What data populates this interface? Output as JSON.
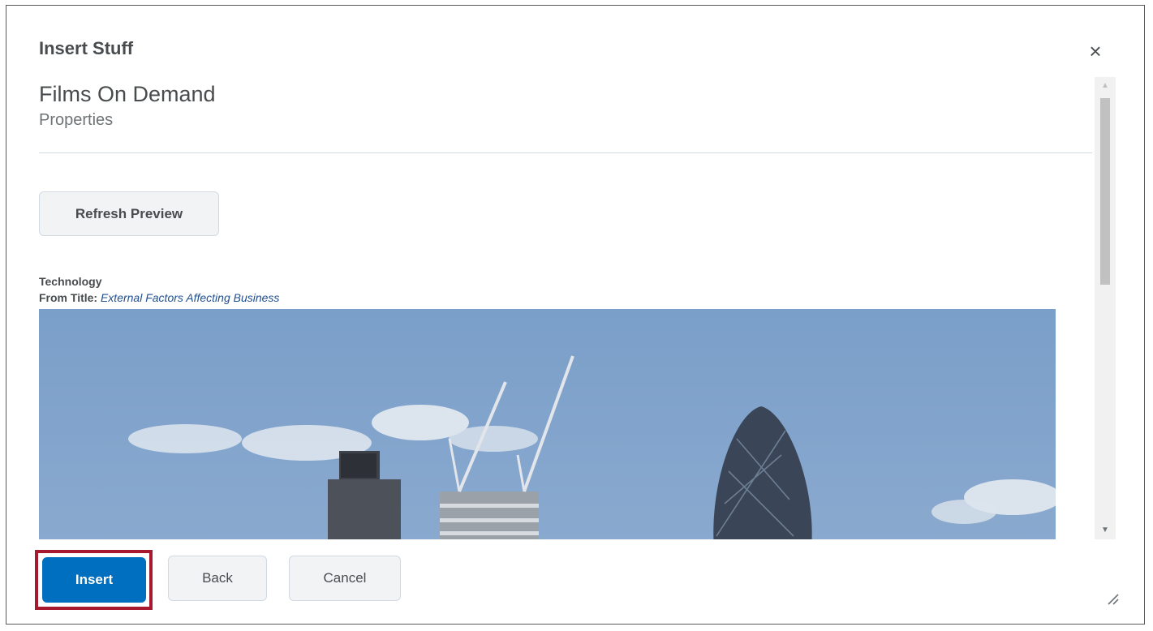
{
  "dialog": {
    "title": "Insert Stuff",
    "close_label": "×"
  },
  "content": {
    "heading": "Films On Demand",
    "subheading": "Properties",
    "refresh_label": "Refresh Preview",
    "clip_title": "Technology",
    "from_title_label": "From Title:",
    "from_title_value": "External Factors Affecting Business"
  },
  "footer": {
    "insert_label": "Insert",
    "back_label": "Back",
    "cancel_label": "Cancel"
  },
  "icons": {
    "close": "close-icon",
    "scroll_up": "chevron-up-icon",
    "scroll_down": "chevron-down-icon",
    "resize": "resize-handle-icon"
  },
  "colors": {
    "primary": "#006fbf",
    "highlight": "#a6192e",
    "link": "#1f4f8f"
  }
}
